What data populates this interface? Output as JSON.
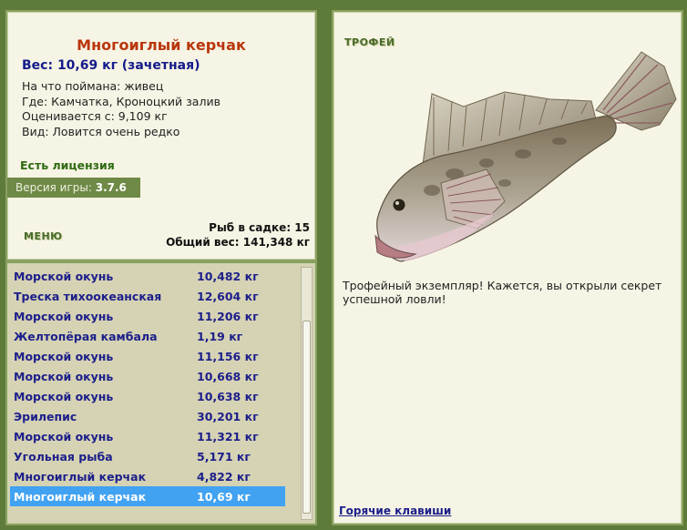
{
  "fish": {
    "title": "Многоиглый керчак",
    "weight_line": "Вес: 10,69 кг (зачетная)",
    "bait": "На что поймана: живец",
    "place": "Где: Камчатка, Кроноцкий залив",
    "min_weight": "Оценивается с: 9,109 кг",
    "rarity": "Вид: Ловится очень редко"
  },
  "license": "Есть лицензия",
  "version": {
    "label": "Версия игры:",
    "value": "3.7.6"
  },
  "menu_label": "МЕНЮ",
  "totals": {
    "count": "Рыб в садке: 15",
    "weight": "Общий вес: 141,348 кг"
  },
  "catch_list": [
    {
      "name": "Морской окунь",
      "weight": "10,482 кг"
    },
    {
      "name": "Треска тихоокеанская",
      "weight": "12,604 кг"
    },
    {
      "name": "Морской окунь",
      "weight": "11,206 кг"
    },
    {
      "name": "Желтопёрая камбала",
      "weight": "1,19 кг"
    },
    {
      "name": "Морской окунь",
      "weight": "11,156 кг"
    },
    {
      "name": "Морской окунь",
      "weight": "10,668 кг"
    },
    {
      "name": "Морской окунь",
      "weight": "10,638 кг"
    },
    {
      "name": "Эрилепис",
      "weight": "30,201 кг"
    },
    {
      "name": "Морской окунь",
      "weight": "11,321 кг"
    },
    {
      "name": "Угольная рыба",
      "weight": "5,171 кг"
    },
    {
      "name": "Многоиглый керчак",
      "weight": "4,822 кг"
    },
    {
      "name": "Многоиглый керчак",
      "weight": "10,69 кг"
    }
  ],
  "selected_index": 11,
  "trophy": {
    "label": "ТРОФЕЙ",
    "text": "Трофейный экземпляр! Кажется, вы открыли секрет успешной ловли!"
  },
  "hotkeys_label": "Горячие клавиши",
  "colors": {
    "background": "#5e7b3a",
    "panel": "#f6f4e4",
    "title": "#b9360c",
    "link": "#1c1f8a",
    "selected_row": "#41a2f2"
  }
}
